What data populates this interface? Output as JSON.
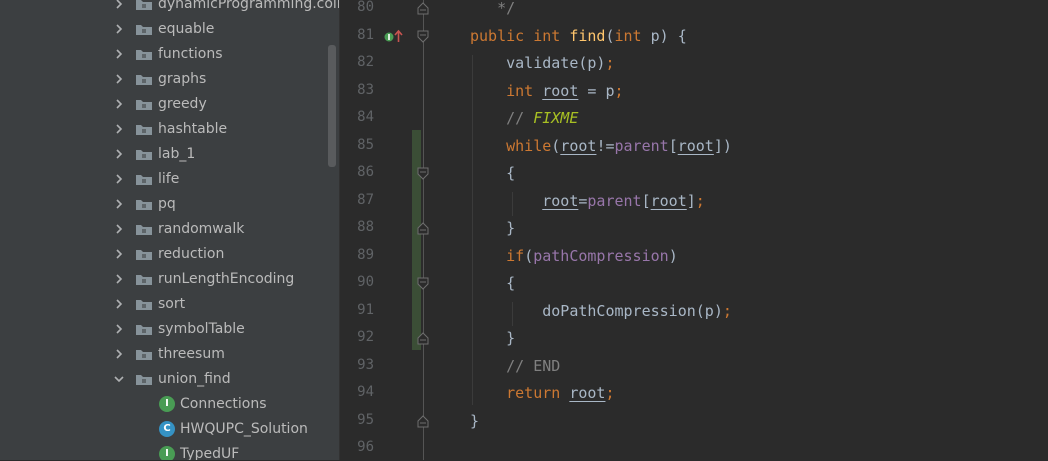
{
  "sidebar": {
    "folders": [
      {
        "label": "dynamicProgramming.coins",
        "expanded": false
      },
      {
        "label": "equable",
        "expanded": false
      },
      {
        "label": "functions",
        "expanded": false
      },
      {
        "label": "graphs",
        "expanded": false
      },
      {
        "label": "greedy",
        "expanded": false
      },
      {
        "label": "hashtable",
        "expanded": false
      },
      {
        "label": "lab_1",
        "expanded": false
      },
      {
        "label": "life",
        "expanded": false
      },
      {
        "label": "pq",
        "expanded": false
      },
      {
        "label": "randomwalk",
        "expanded": false
      },
      {
        "label": "reduction",
        "expanded": false
      },
      {
        "label": "runLengthEncoding",
        "expanded": false
      },
      {
        "label": "sort",
        "expanded": false
      },
      {
        "label": "symbolTable",
        "expanded": false
      },
      {
        "label": "threesum",
        "expanded": false
      },
      {
        "label": "union_find",
        "expanded": true
      }
    ],
    "files": [
      {
        "label": "Connections",
        "badge": "I",
        "badge_color": "#499c54"
      },
      {
        "label": "HWQUPC_Solution",
        "badge": "C",
        "badge_color": "#3592c4"
      },
      {
        "label": "TypedUF",
        "badge": "I",
        "badge_color": "#499c54"
      }
    ]
  },
  "editor": {
    "lines": [
      {
        "num": "80",
        "code": "   */"
      },
      {
        "num": "81",
        "code": "public int find(int p) {"
      },
      {
        "num": "82",
        "code": "    validate(p);"
      },
      {
        "num": "83",
        "code": "    int root = p;"
      },
      {
        "num": "84",
        "code": "    // FIXME"
      },
      {
        "num": "85",
        "code": "    while(root!=parent[root])"
      },
      {
        "num": "86",
        "code": "    {"
      },
      {
        "num": "87",
        "code": "        root=parent[root];"
      },
      {
        "num": "88",
        "code": "    }"
      },
      {
        "num": "89",
        "code": "    if(pathCompression)"
      },
      {
        "num": "90",
        "code": "    {"
      },
      {
        "num": "91",
        "code": "        doPathCompression(p);"
      },
      {
        "num": "92",
        "code": "    }"
      },
      {
        "num": "93",
        "code": "    // END"
      },
      {
        "num": "94",
        "code": "    return root;"
      },
      {
        "num": "95",
        "code": "}"
      },
      {
        "num": "96",
        "code": ""
      }
    ],
    "gutter_icons": {
      "line_81": [
        "implements-icon",
        "override-up-arrow-icon"
      ]
    }
  },
  "colors": {
    "sidebar_bg": "#3c3f41",
    "editor_bg": "#2b2b2b",
    "keyword": "#cc7832",
    "method": "#ffc66d",
    "field": "#9876aa",
    "comment": "#808080",
    "todo": "#a8c023",
    "text": "#a9b7c6",
    "vcs_modified": "#3b4e36"
  }
}
